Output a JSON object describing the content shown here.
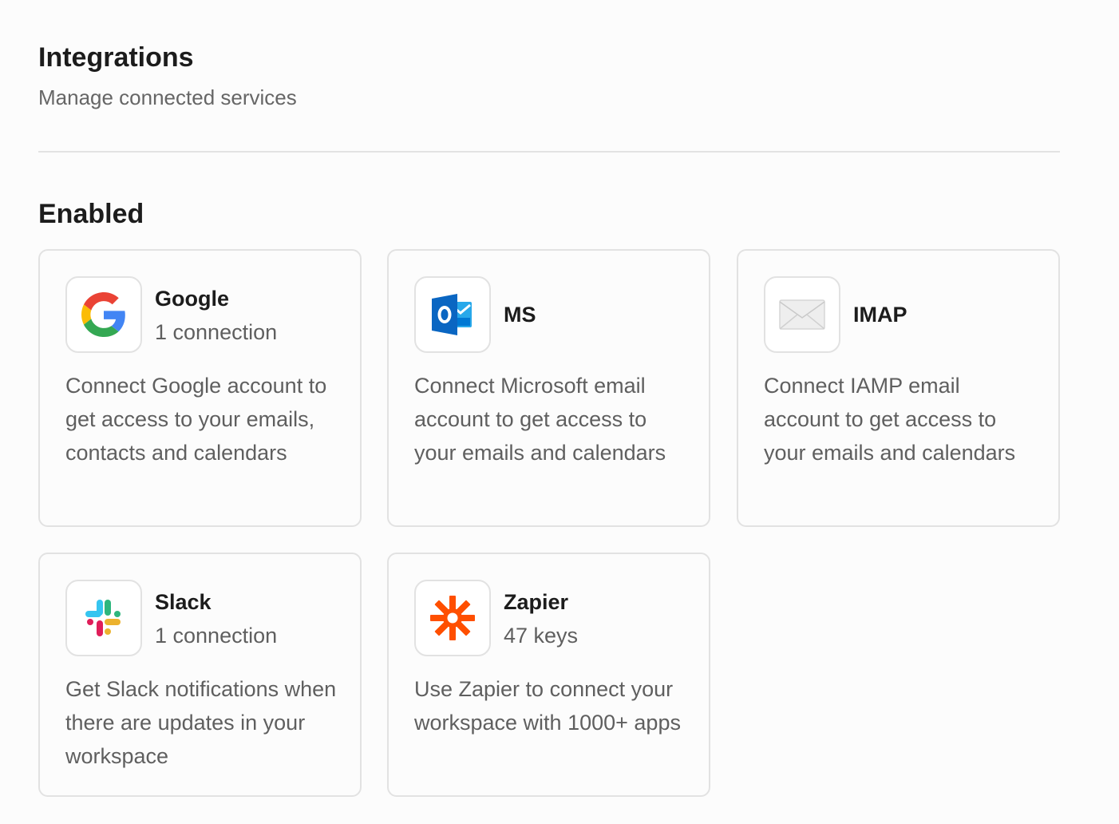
{
  "header": {
    "title": "Integrations",
    "subtitle": "Manage connected services"
  },
  "section": {
    "title": "Enabled"
  },
  "integrations": [
    {
      "name": "Google",
      "meta": "1 connection",
      "icon": "google-logo-icon",
      "description": "Connect Google account to get access to your emails, contacts and calendars"
    },
    {
      "name": "MS",
      "meta": "",
      "icon": "outlook-logo-icon",
      "description": "Connect Microsoft email account to get access to your emails and calendars"
    },
    {
      "name": "IMAP",
      "meta": "",
      "icon": "envelope-icon",
      "description": "Connect IAMP email account to get access to your emails and calendars"
    },
    {
      "name": "Slack",
      "meta": "1 connection",
      "icon": "slack-logo-icon",
      "description": "Get Slack notifications when there are updates in your workspace"
    },
    {
      "name": "Zapier",
      "meta": "47 keys",
      "icon": "zapier-logo-icon",
      "description": "Use Zapier to connect your workspace with 1000+ apps"
    }
  ],
  "colors": {
    "background": "#fcfcfc",
    "border": "#e2e2e2",
    "text_primary": "#1c1c1c",
    "text_secondary": "#5f5f5f",
    "zapier_orange": "#ff4f00",
    "outlook_blue": "#0a66c2"
  }
}
